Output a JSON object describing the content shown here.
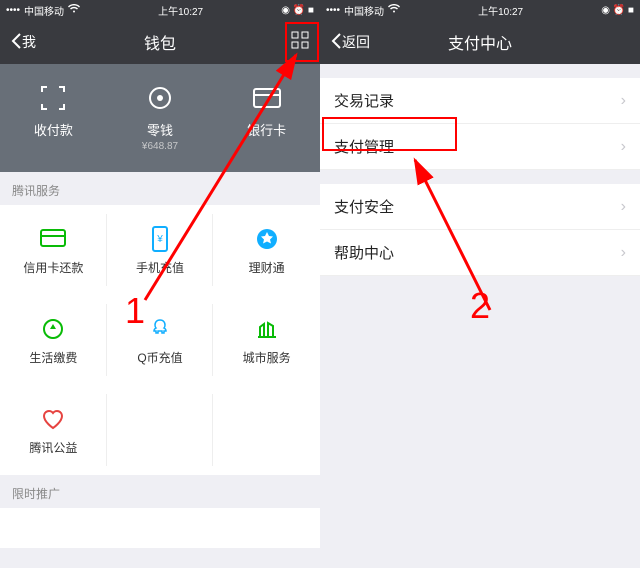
{
  "statusbar": {
    "carrier": "中国移动",
    "time": "上午10:27",
    "icons": "◉ ⏰ ■"
  },
  "left": {
    "back": "我",
    "title": "钱包",
    "panel": [
      {
        "icon": "scan",
        "label": "收付款",
        "sub": ""
      },
      {
        "icon": "wallet",
        "label": "零钱",
        "sub": "¥648.87"
      },
      {
        "icon": "card",
        "label": "银行卡",
        "sub": ""
      }
    ],
    "section1": "腾讯服务",
    "grid": [
      {
        "icon": "card-green",
        "label": "信用卡还款"
      },
      {
        "icon": "phone",
        "label": "手机充值"
      },
      {
        "icon": "licai",
        "label": "理财通"
      },
      {
        "icon": "lifepay",
        "label": "生活缴费"
      },
      {
        "icon": "qcoin",
        "label": "Q币充值"
      },
      {
        "icon": "city",
        "label": "城市服务"
      },
      {
        "icon": "charity",
        "label": "腾讯公益"
      }
    ],
    "section2": "限时推广"
  },
  "right": {
    "back": "返回",
    "title": "支付中心",
    "items": [
      "交易记录",
      "支付管理",
      "支付安全",
      "帮助中心"
    ]
  },
  "annotations": {
    "label1": "1",
    "label2": "2"
  }
}
